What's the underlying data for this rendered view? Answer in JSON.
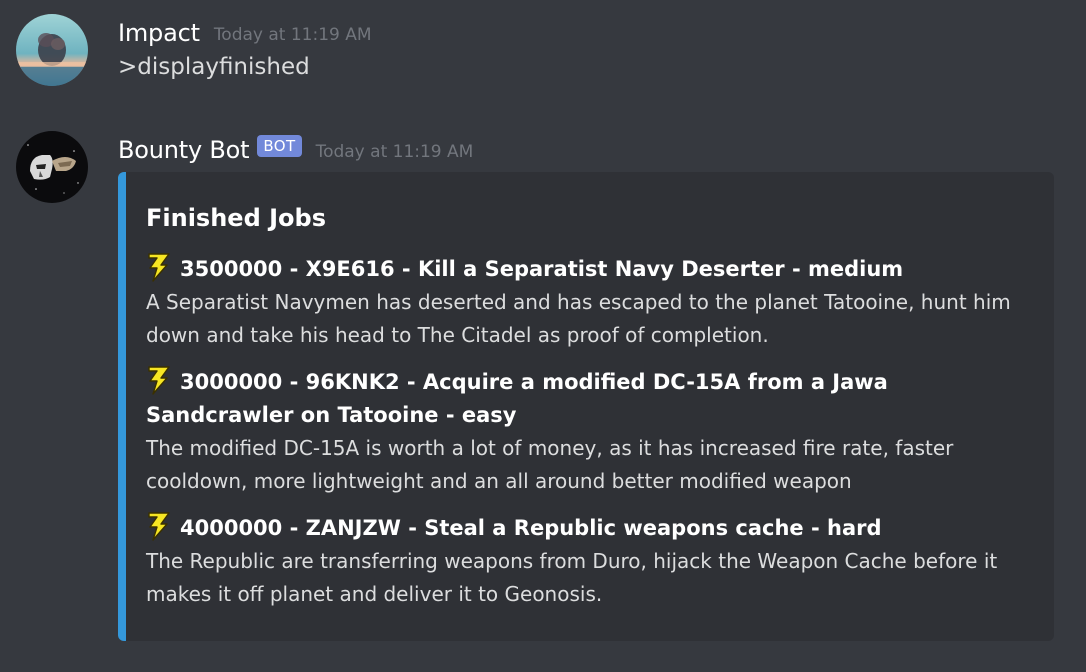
{
  "messages": [
    {
      "username": "Impact",
      "timestamp": "Today at 11:19 AM",
      "content": ">displayfinished"
    },
    {
      "username": "Bounty Bot",
      "bot_tag": "BOT",
      "timestamp": "Today at 11:19 AM",
      "embed": {
        "color": "#3498db",
        "title": "Finished Jobs",
        "jobs": [
          {
            "icon": "lightning-bolt-icon",
            "title": "3500000 - X9E616 - Kill a Separatist Navy Deserter - medium",
            "description": "A Separatist Navymen has deserted and has escaped to the planet Tatooine, hunt him down and take his head to The Citadel as proof of completion."
          },
          {
            "icon": "lightning-bolt-icon",
            "title": "3000000 - 96KNK2 - Acquire a modified DC-15A from a Jawa Sandcrawler on Tatooine - easy",
            "description": "The modified DC-15A is worth a lot of money, as it has increased fire rate, faster cooldown, more lightweight and an all around better modified weapon"
          },
          {
            "icon": "lightning-bolt-icon",
            "title": "4000000 - ZANJZW - Steal a Republic weapons cache - hard",
            "description": "The Republic are transferring weapons from Duro, hijack the Weapon Cache before it makes it off planet and deliver it to Geonosis."
          }
        ]
      }
    }
  ],
  "colors": {
    "background": "#36393f",
    "embed_background": "#2f3136",
    "embed_accent": "#3498db",
    "bot_tag": "#7289da",
    "timestamp": "#72767d"
  }
}
